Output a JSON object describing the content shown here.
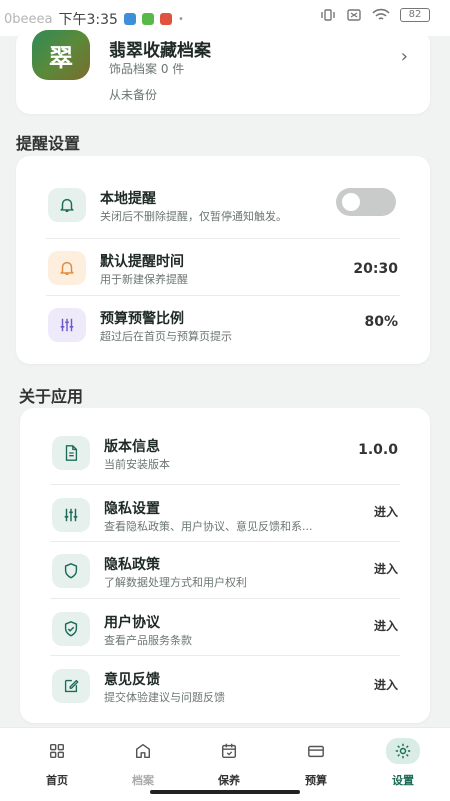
{
  "status_bar": {
    "carrier": "0beeea",
    "time": "下午3:35",
    "battery": "82"
  },
  "archive": {
    "logo_char": "翠",
    "title": "翡翠收藏档案",
    "subtitle": "饰品档案 0 件",
    "backup": "从未备份",
    "chevron": "›"
  },
  "reminder_section": {
    "title": "提醒设置",
    "items": [
      {
        "title": "本地提醒",
        "sub": "关闭后不删除提醒，仅暂停通知触发。",
        "toggle_on": false
      },
      {
        "title": "默认提醒时间",
        "sub": "用于新建保养提醒",
        "value": "20:30"
      },
      {
        "title": "预算预警比例",
        "sub": "超过后在首页与预算页提示",
        "value": "80%"
      }
    ]
  },
  "about_section": {
    "title": "关于应用",
    "items": [
      {
        "title": "版本信息",
        "sub": "当前安装版本",
        "value": "1.0.0"
      },
      {
        "title": "隐私设置",
        "sub": "查看隐私政策、用户协议、意见反馈和系...",
        "value": "进入"
      },
      {
        "title": "隐私政策",
        "sub": "了解数据处理方式和用户权利",
        "value": "进入"
      },
      {
        "title": "用户协议",
        "sub": "查看产品服务条款",
        "value": "进入"
      },
      {
        "title": "意见反馈",
        "sub": "提交体验建议与问题反馈",
        "value": "进入"
      }
    ]
  },
  "tabs": [
    {
      "label": "首页",
      "icon": "grid-icon",
      "active": false
    },
    {
      "label": "档案",
      "icon": "archive-home-icon",
      "active": false
    },
    {
      "label": "保养",
      "icon": "calendar-icon",
      "active": false
    },
    {
      "label": "预算",
      "icon": "card-icon",
      "active": false
    },
    {
      "label": "设置",
      "icon": "gear-icon",
      "active": true
    }
  ],
  "colors": {
    "accent": "#1d6b56",
    "bell_bg": "#e6f1ee",
    "orange_bg": "#fdeede",
    "purple_bg": "#eeeafa",
    "green_bg": "#e6f1ee"
  }
}
